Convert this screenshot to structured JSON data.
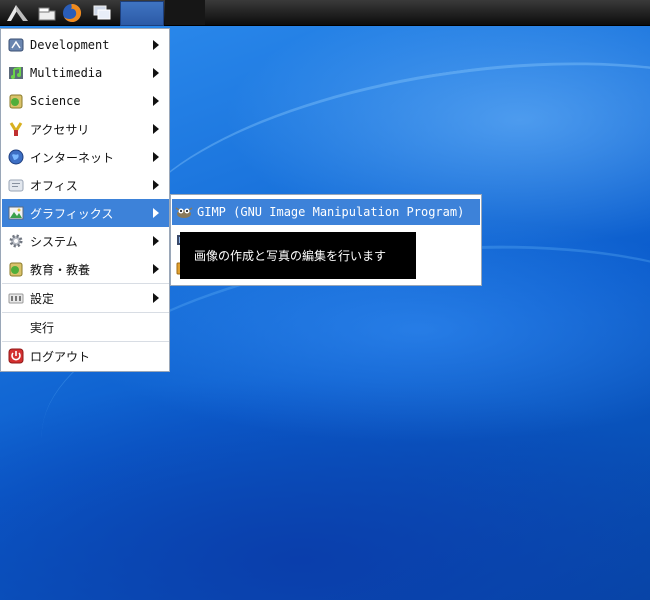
{
  "panel": {
    "icons": [
      "lxde-menu-icon",
      "terminal-icon",
      "firefox-icon",
      "windows-icon"
    ],
    "task_button": ""
  },
  "menu": {
    "items": [
      {
        "label": "Development",
        "icon": "development-icon",
        "submenu": true
      },
      {
        "label": "Multimedia",
        "icon": "multimedia-icon",
        "submenu": true
      },
      {
        "label": "Science",
        "icon": "science-icon",
        "submenu": true
      },
      {
        "label": "アクセサリ",
        "icon": "accessories-icon",
        "submenu": true
      },
      {
        "label": "インターネット",
        "icon": "internet-icon",
        "submenu": true
      },
      {
        "label": "オフィス",
        "icon": "office-icon",
        "submenu": true
      },
      {
        "label": "グラフィックス",
        "icon": "graphics-icon",
        "submenu": true,
        "active": true
      },
      {
        "label": "システム",
        "icon": "system-icon",
        "submenu": true
      },
      {
        "label": "教育・教養",
        "icon": "education-icon",
        "submenu": true
      },
      {
        "label": "設定",
        "icon": "settings-icon",
        "submenu": true
      },
      {
        "label": "実行",
        "icon": "",
        "submenu": false
      },
      {
        "label": "ログアウト",
        "icon": "logout-icon",
        "submenu": false
      }
    ]
  },
  "submenu": {
    "items": [
      {
        "label": "GIMP (GNU Image Manipulation Program)",
        "icon": "gimp-icon",
        "active": true
      },
      {
        "label": "",
        "icon": "image-viewer-icon"
      },
      {
        "label": "",
        "icon": "folder-image-icon"
      }
    ]
  },
  "tooltip": {
    "text": "画像の作成と写真の編集を行います"
  },
  "colors": {
    "highlight": "#3d82d9",
    "desktop": "#1a73dc",
    "panel": "#0c0c0c"
  }
}
